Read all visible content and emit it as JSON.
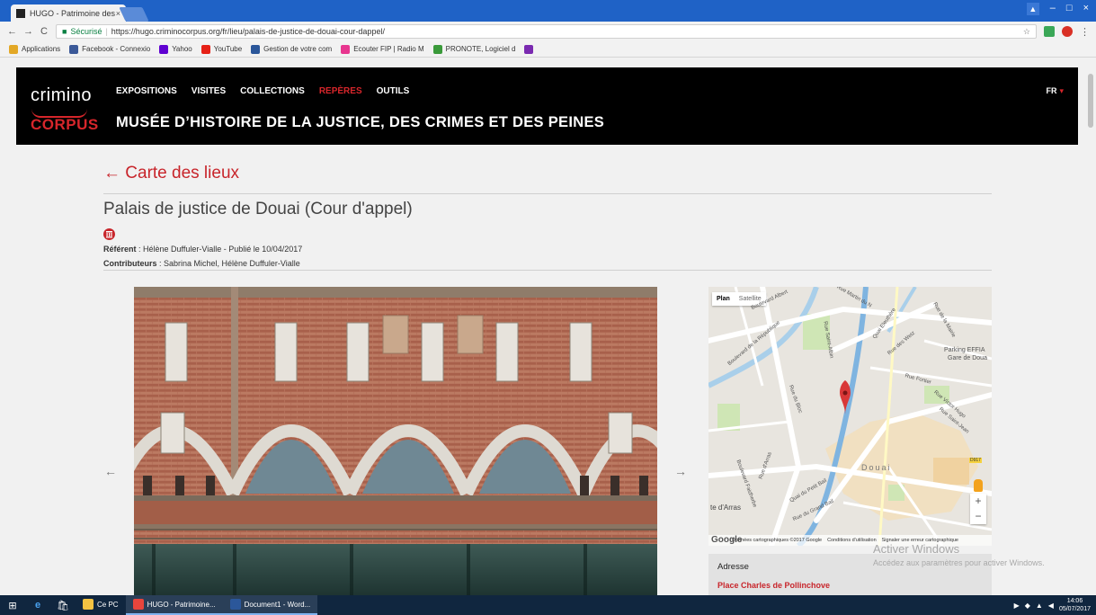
{
  "browser": {
    "tab_title": "HUGO - Patrimoine des",
    "tab_close": "×",
    "window_user": "▲",
    "window_min": "–",
    "window_max": "□",
    "window_close": "×",
    "back_icon": "←",
    "forward_icon": "→",
    "reload_icon": "C",
    "secure_label": "Sécurisé",
    "url": "https://hugo.criminocorpus.org/fr/lieu/palais-de-justice-de-douai-cour-dappel/",
    "star_icon": "☆",
    "menu_icon": "⋮",
    "bookmarks": [
      {
        "label": "Applications",
        "color": "#e3a826"
      },
      {
        "label": "Facebook - Connexio",
        "color": "#3b5998"
      },
      {
        "label": "Yahoo",
        "color": "#5f01d1"
      },
      {
        "label": "YouTube",
        "color": "#e62117"
      },
      {
        "label": "Gestion de votre com",
        "color": "#2b579a"
      },
      {
        "label": "Ecouter FIP | Radio M",
        "color": "#e8368f"
      },
      {
        "label": "PRONOTE, Logiciel d",
        "color": "#3a9a3a"
      },
      {
        "label": "",
        "color": "#7a2ab0"
      }
    ]
  },
  "site": {
    "logo_top": "crimino",
    "logo_bottom": "CORPUS",
    "nav": [
      "EXPOSITIONS",
      "VISITES",
      "COLLECTIONS",
      "REPÈRES",
      "OUTILS"
    ],
    "active_nav": "REPÈRES",
    "title": "MUSÉE D’HISTOIRE DE LA JUSTICE, DES CRIMES ET DES PEINES",
    "lang": "FR",
    "lang_caret": "▾"
  },
  "page": {
    "back_link": "← Carte des lieux",
    "title": "Palais de justice de Douai (Cour d'appel)",
    "referent_label": "Référent",
    "referent_text": " : Hélène Duffuler-Vialle - Publié le 10/04/2017",
    "contrib_label": "Contributeurs",
    "contrib_text": " : Sabrina Michel, Hélène Duffuler-Vialle",
    "prev_arrow": "←",
    "next_arrow": "→"
  },
  "map": {
    "tab_plan": "Plan",
    "tab_satellite": "Satellite",
    "zoom_in": "+",
    "zoom_out": "−",
    "google": "Google",
    "footer": [
      "Données cartographiques ©2017 Google",
      "Conditions d'utilisation",
      "Signaler une erreur cartographique"
    ],
    "labels": {
      "city": "Douai",
      "parking": "Parking EFFIA",
      "gare": "Gare de Doua",
      "arras": "te d'Arras",
      "road": "D917"
    },
    "street_labels": [
      "Boulevard Albert",
      "Rue Martin du N",
      "Boulevard de la République",
      "Rue Saint-Albin",
      "Quai Eleuthère",
      "Rue des Wetz",
      "Rue de la Mairie",
      "Rue Fortier",
      "Rue Victor Hugo",
      "Rue Saint-Jean",
      "Rue du Bloc",
      "Rue d'Arras",
      "Quai du Petit Bail",
      "Rue du Grand Bail",
      "Boulevard Faidherbe"
    ]
  },
  "address": {
    "label": "Adresse",
    "value": "Place Charles de Pollinchove"
  },
  "watermark": {
    "line1": "Activer Windows",
    "line2": "Accédez aux paramètres pour activer Windows."
  },
  "taskbar": {
    "start_icon": "⊞",
    "edge_icon": "e",
    "store_icon": "🛍",
    "apps": [
      {
        "label": "Ce PC",
        "color": "#f3c242",
        "open": false
      },
      {
        "label": "HUGO - Patrimoine...",
        "color": "#e8453c",
        "open": true
      },
      {
        "label": "Document1 - Word...",
        "color": "#2b579a",
        "open": true
      }
    ],
    "clock_time": "14:06",
    "clock_date": "05/07/2017"
  }
}
